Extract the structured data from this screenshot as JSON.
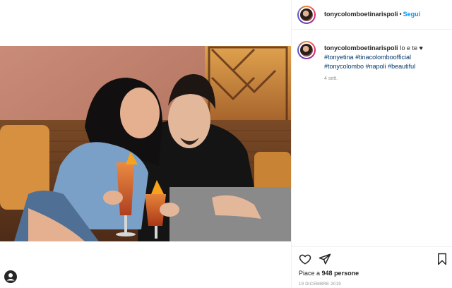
{
  "post": {
    "username": "tonycolomboetinarispoli",
    "dot": "•",
    "follow_label": "Segui",
    "caption_text": "Io e te ♥",
    "hashtags": [
      "#tonyetina",
      "#tinacolomboofficial",
      "#tonycolombo",
      "#napoli",
      "#beautiful"
    ],
    "age": "4 sett.",
    "likes_prefix": "Piace a",
    "likes_count": "948 persone",
    "date": "19 DICEMBRE 2019"
  },
  "icons": {
    "like": "heart-icon",
    "share": "paper-plane-icon",
    "save": "bookmark-icon",
    "profile": "user-icon"
  },
  "colors": {
    "link_blue": "#0095f6",
    "hashtag_blue": "#00376b",
    "secondary_text": "#8e8e8e"
  }
}
